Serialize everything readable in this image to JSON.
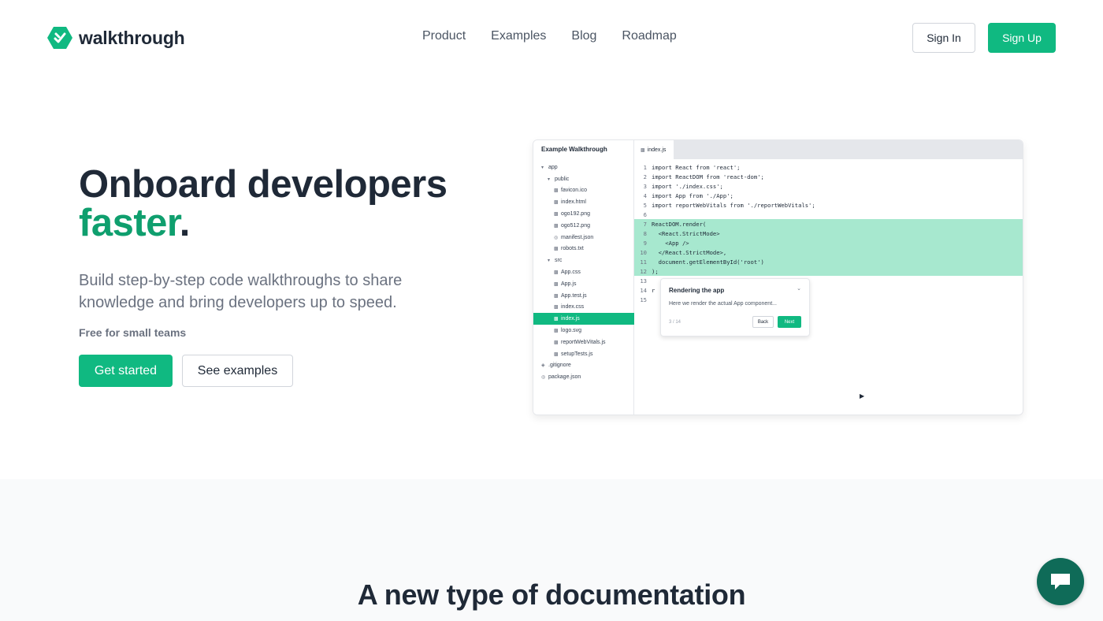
{
  "brand": {
    "name": "walkthrough",
    "accent": "#10b981"
  },
  "nav": {
    "items": [
      "Product",
      "Examples",
      "Blog",
      "Roadmap"
    ]
  },
  "auth": {
    "signin_label": "Sign In",
    "signup_label": "Sign Up"
  },
  "hero": {
    "title_line1": "Onboard developers",
    "title_accent": "faster",
    "title_period": ".",
    "subtitle": "Build step-by-step code walkthroughs to share knowledge and bring developers up to speed.",
    "note": "Free for small teams",
    "primary_cta": "Get started",
    "secondary_cta": "See examples"
  },
  "preview": {
    "sidebar_title": "Example Walkthrough",
    "tree": [
      {
        "label": "app",
        "depth": 0,
        "icon": "folder-open",
        "active": false
      },
      {
        "label": "public",
        "depth": 1,
        "icon": "folder-open",
        "active": false
      },
      {
        "label": "favicon.ico",
        "depth": 2,
        "icon": "file",
        "active": false
      },
      {
        "label": "index.html",
        "depth": 2,
        "icon": "file",
        "active": false
      },
      {
        "label": "ogo192.png",
        "depth": 2,
        "icon": "file",
        "active": false
      },
      {
        "label": "ogo512.png",
        "depth": 2,
        "icon": "file",
        "active": false
      },
      {
        "label": "manifest.json",
        "depth": 2,
        "icon": "json",
        "active": false
      },
      {
        "label": "robots.txt",
        "depth": 2,
        "icon": "file",
        "active": false
      },
      {
        "label": "src",
        "depth": 1,
        "icon": "folder-open",
        "active": false
      },
      {
        "label": "App.css",
        "depth": 2,
        "icon": "file",
        "active": false
      },
      {
        "label": "App.js",
        "depth": 2,
        "icon": "file",
        "active": false
      },
      {
        "label": "App.test.js",
        "depth": 2,
        "icon": "file",
        "active": false
      },
      {
        "label": "index.css",
        "depth": 2,
        "icon": "file",
        "active": false
      },
      {
        "label": "index.js",
        "depth": 2,
        "icon": "file",
        "active": true
      },
      {
        "label": "logo.svg",
        "depth": 2,
        "icon": "file",
        "active": false
      },
      {
        "label": "reportWebVitals.js",
        "depth": 2,
        "icon": "file",
        "active": false
      },
      {
        "label": "setupTests.js",
        "depth": 2,
        "icon": "file",
        "active": false
      },
      {
        "label": ".gitignore",
        "depth": 0,
        "icon": "config",
        "active": false
      },
      {
        "label": "package.json",
        "depth": 0,
        "icon": "json",
        "active": false
      }
    ],
    "tab_label": "index.js",
    "code": [
      {
        "n": "1",
        "text": "import React from 'react';",
        "hl": false
      },
      {
        "n": "2",
        "text": "import ReactDOM from 'react-dom';",
        "hl": false
      },
      {
        "n": "3",
        "text": "import './index.css';",
        "hl": false
      },
      {
        "n": "4",
        "text": "import App from './App';",
        "hl": false
      },
      {
        "n": "5",
        "text": "import reportWebVitals from './reportWebVitals';",
        "hl": false
      },
      {
        "n": "6",
        "text": "",
        "hl": false
      },
      {
        "n": "7",
        "text": "ReactDOM.render(",
        "hl": true
      },
      {
        "n": "8",
        "text": "  <React.StrictMode>",
        "hl": true
      },
      {
        "n": "9",
        "text": "    <App />",
        "hl": true
      },
      {
        "n": "10",
        "text": "  </React.StrictMode>,",
        "hl": true
      },
      {
        "n": "11",
        "text": "  document.getElementById('root')",
        "hl": true
      },
      {
        "n": "12",
        "text": ");",
        "hl": true
      },
      {
        "n": "13",
        "text": "",
        "hl": false
      },
      {
        "n": "14",
        "text": "r",
        "hl": false
      },
      {
        "n": "15",
        "text": "",
        "hl": false
      }
    ],
    "tooltip": {
      "title": "Rendering the app",
      "body": "Here we render the actual App component...",
      "count": "3 / 14",
      "back_label": "Back",
      "next_label": "Next"
    }
  },
  "section2": {
    "title": "A new type of documentation"
  },
  "icons": {
    "logo": "walkthrough-logo-icon",
    "chat": "chat-bubble-icon",
    "chevron": "chevron-down-icon",
    "cursor": "cursor-icon"
  }
}
